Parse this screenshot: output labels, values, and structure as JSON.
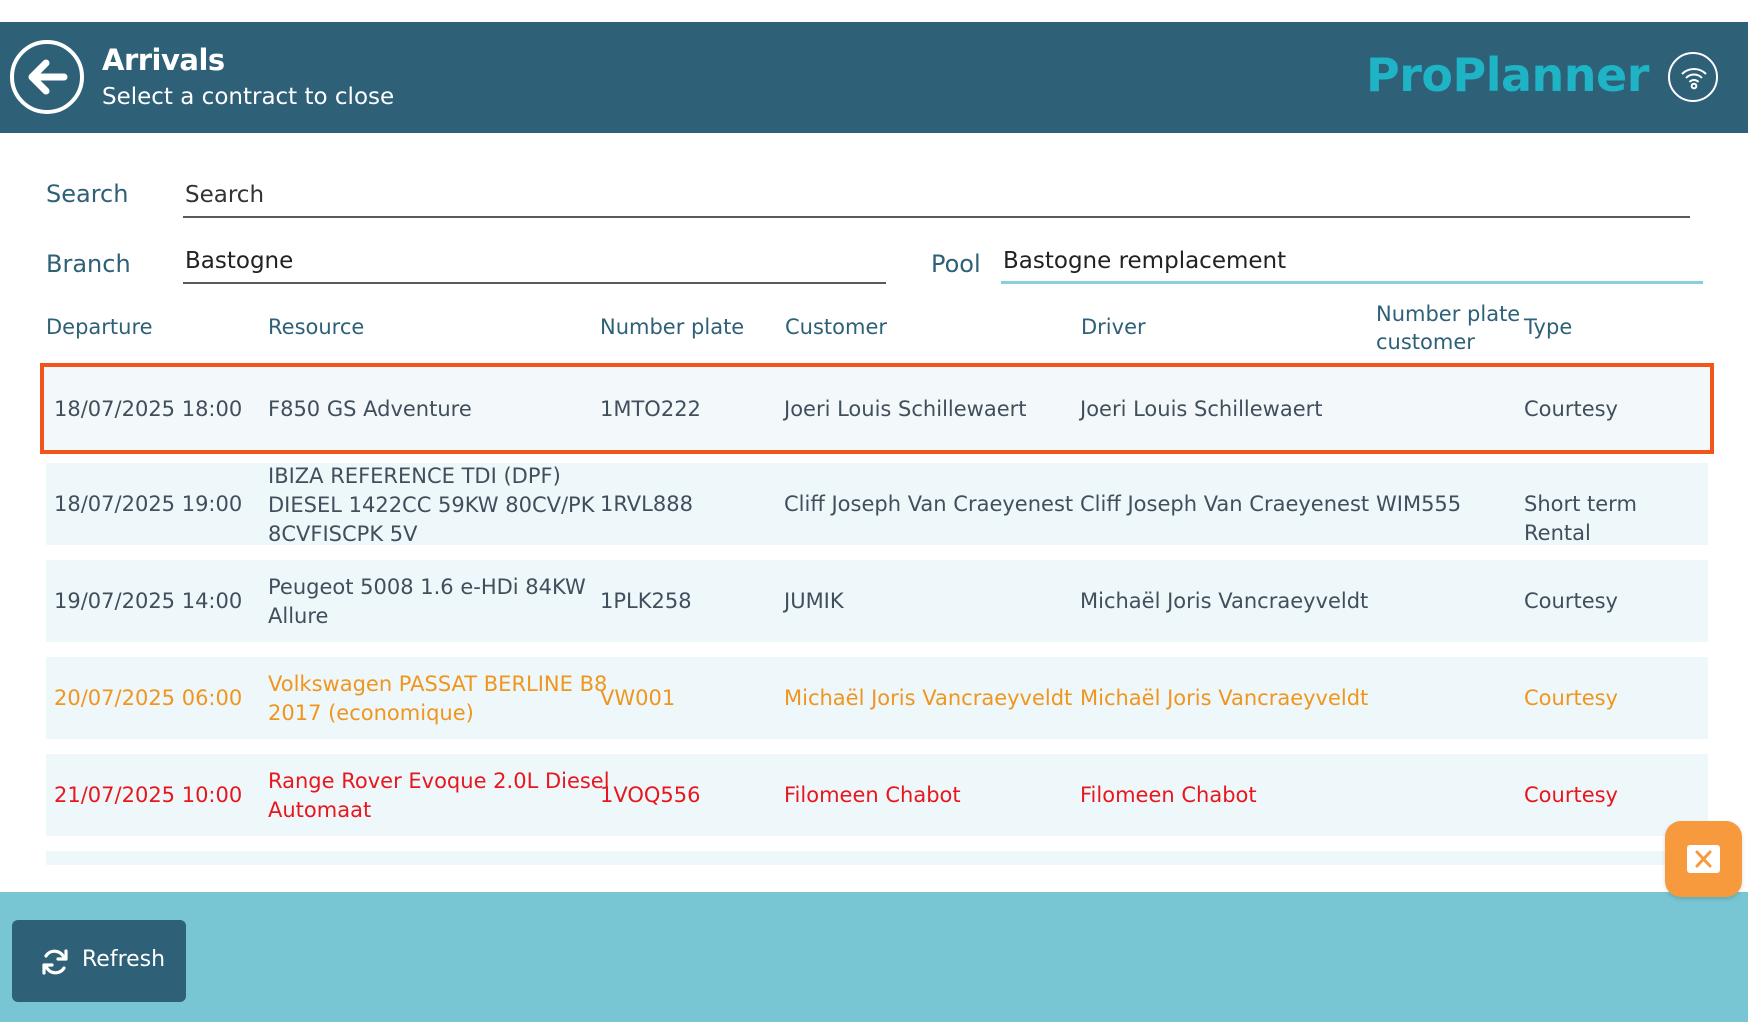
{
  "header": {
    "title": "Arrivals",
    "subtitle": "Select a contract to close",
    "logo_text": "ProPlanner",
    "back_icon": "back-arrow-icon",
    "status_icon": "wifi-icon"
  },
  "filters": {
    "search_label": "Search",
    "search_value": "Search",
    "branch_label": "Branch",
    "branch_value": "Bastogne",
    "pool_label": "Pool",
    "pool_value": "Bastogne remplacement"
  },
  "table": {
    "headers": {
      "departure": "Departure",
      "resource": "Resource",
      "number_plate": "Number plate",
      "customer": "Customer",
      "driver": "Driver",
      "number_plate_customer_1": "Number plate",
      "number_plate_customer_2": "customer",
      "type": "Type"
    },
    "rows": [
      {
        "departure": "18/07/2025 18:00",
        "resource": [
          "F850 GS Adventure"
        ],
        "number_plate": "1MTO222",
        "customer": "Joeri Louis Schillewaert",
        "driver": "Joeri Louis Schillewaert",
        "number_plate_customer": "",
        "type": "Courtesy",
        "status": "selected"
      },
      {
        "departure": "18/07/2025 19:00",
        "resource": [
          "IBIZA REFERENCE TDI (DPF)",
          "DIESEL 1422CC 59KW 80CV/PK",
          "8CVFISCPK 5V"
        ],
        "number_plate": "1RVL888",
        "customer": "Cliff Joseph Van Craeyenest",
        "driver": "Cliff Joseph Van Craeyenest",
        "number_plate_customer": "WIM555",
        "type": "Short term Rental",
        "status": "normal"
      },
      {
        "departure": "19/07/2025 14:00",
        "resource": [
          "Peugeot 5008 1.6 e-HDi 84KW",
          "Allure"
        ],
        "number_plate": "1PLK258",
        "customer": "JUMIK",
        "driver": "Michaël Joris Vancraeyveldt",
        "number_plate_customer": "",
        "type": "Courtesy",
        "status": "normal"
      },
      {
        "departure": "20/07/2025 06:00",
        "resource": [
          "Volkswagen PASSAT BERLINE B8",
          "2017 (economique)"
        ],
        "number_plate": "VW001",
        "customer": "Michaël Joris Vancraeyveldt",
        "driver": "Michaël Joris Vancraeyveldt",
        "number_plate_customer": "",
        "type": "Courtesy",
        "status": "warning"
      },
      {
        "departure": "21/07/2025 10:00",
        "resource": [
          "Range Rover Evoque 2.0L Diesel",
          "Automaat"
        ],
        "number_plate": "1VOQ556",
        "customer": "Filomeen Chabot",
        "driver": "Filomeen Chabot",
        "number_plate_customer": "",
        "type": "Courtesy",
        "status": "overdue"
      }
    ]
  },
  "footer": {
    "refresh_label": "Refresh",
    "refresh_icon": "refresh-icon",
    "close_icon": "close-icon"
  },
  "colors": {
    "header_bg": "#2e6078",
    "logo": "#1fb3c6",
    "footer_bg": "#78c6d3",
    "selected_border": "#f2541b",
    "warning_text": "#f0961e",
    "overdue_text": "#e8171d",
    "close_button": "#f79a3e",
    "row_bg": "#eef7fa"
  }
}
